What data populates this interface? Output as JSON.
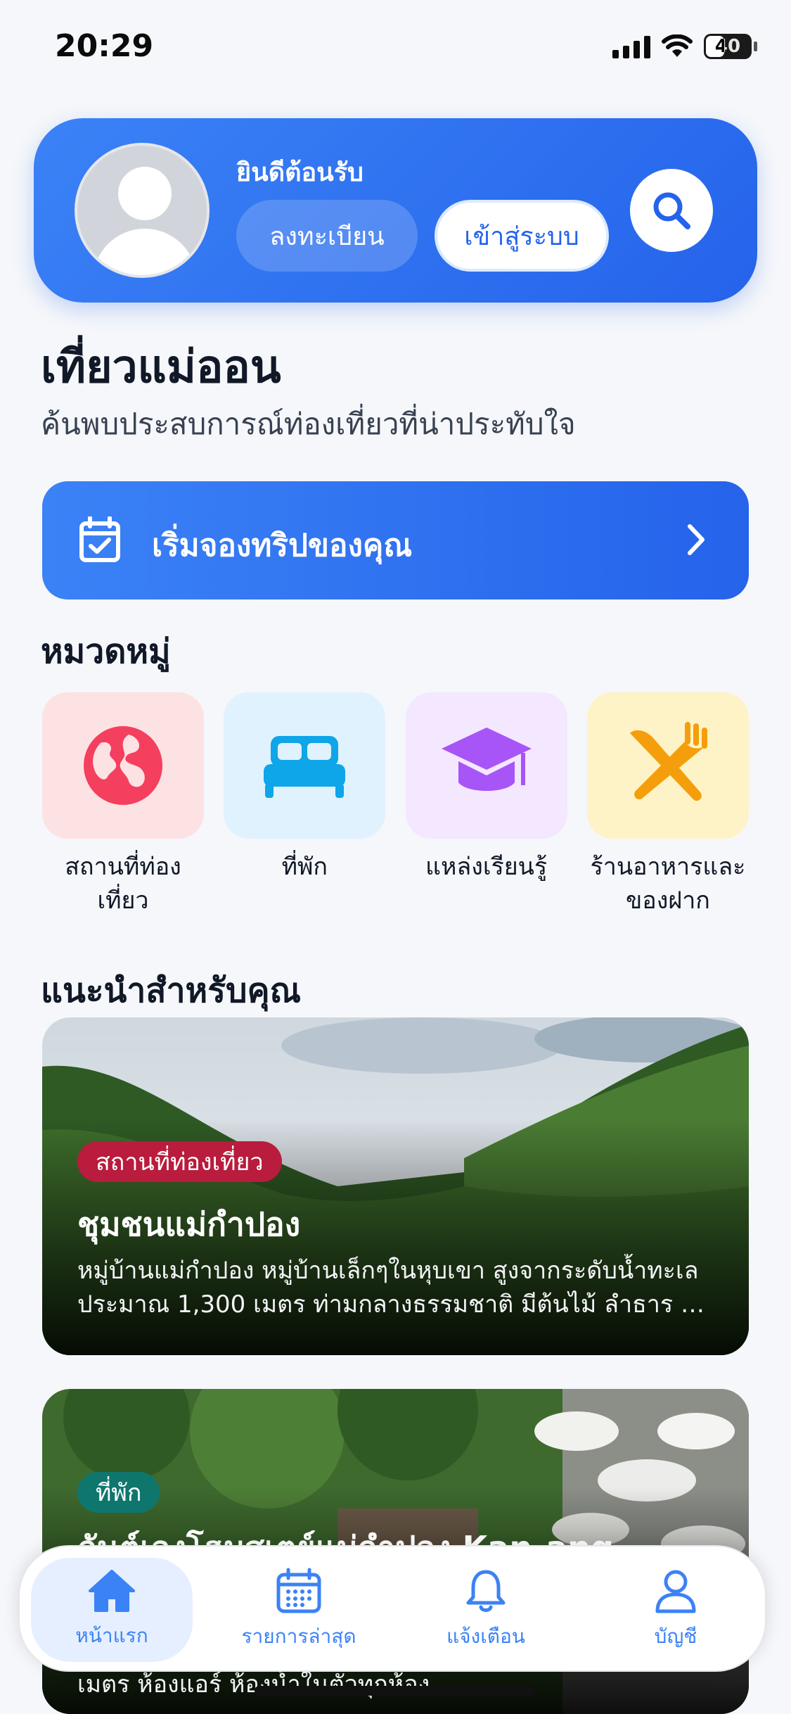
{
  "status": {
    "time": "20:29",
    "battery": "40"
  },
  "header": {
    "welcome": "ยินดีต้อนรับ",
    "register_label": "ลงทะเบียน",
    "login_label": "เข้าสู่ระบบ"
  },
  "page": {
    "title": "เที่ยวแม่ออน",
    "subtitle": "ค้นพบประสบการณ์ท่องเที่ยวที่น่าประทับใจ"
  },
  "trip_banner": {
    "label": "เริ่มจองทริปของคุณ"
  },
  "categories": {
    "title": "หมวดหมู่",
    "items": [
      {
        "label_line1": "สถานที่ท่อง",
        "label_line2": "เที่ยว",
        "icon": "globe-icon",
        "bg": "#fde2e4",
        "color": "#f43f5e"
      },
      {
        "label_line1": "ที่พัก",
        "label_line2": "",
        "icon": "bed-icon",
        "bg": "#e0f2fe",
        "color": "#0ea5e9"
      },
      {
        "label_line1": "แหล่งเรียนรู้",
        "label_line2": "",
        "icon": "graduation-cap-icon",
        "bg": "#f3e8ff",
        "color": "#a855f7"
      },
      {
        "label_line1": "ร้านอาหารและ",
        "label_line2": "ของฝาก",
        "icon": "utensils-icon",
        "bg": "#fef3c7",
        "color": "#f59e0b"
      }
    ]
  },
  "recommendations": {
    "title": "แนะนำสำหรับคุณ",
    "cards": [
      {
        "tag": "สถานที่ท่องเที่ยว",
        "tag_color": "#b91c3c",
        "title": "ชุมชนแม่กำปอง",
        "desc_line1": "หมู่บ้านแม่กำปอง หมู่บ้านเล็กๆในหุบเขา สูงจากระดับน้ำทะเล",
        "desc_line2": "ประมาณ 1,300 เมตร ท่ามกลางธรรมชาติ มีต้นไม้ ลำธาร น้ำ..."
      },
      {
        "tag": "ที่พัก",
        "tag_color": "#0f766e",
        "title": "กันต์เองโฮมสเตย์แม่กำปอง Kan-ang",
        "desc_line1": "เมตร ห้องแอร์ ห้องน้ำในตัวทุกห้อง"
      }
    ]
  },
  "nav": {
    "items": [
      {
        "label": "หน้าแรก",
        "icon": "home-icon",
        "active": true
      },
      {
        "label": "รายการล่าสุด",
        "icon": "calendar-icon",
        "active": false
      },
      {
        "label": "แจ้งเตือน",
        "icon": "bell-icon",
        "active": false
      },
      {
        "label": "บัญชี",
        "icon": "user-icon",
        "active": false
      }
    ]
  },
  "colors": {
    "primary": "#2563eb",
    "accent": "#3b82f6"
  }
}
